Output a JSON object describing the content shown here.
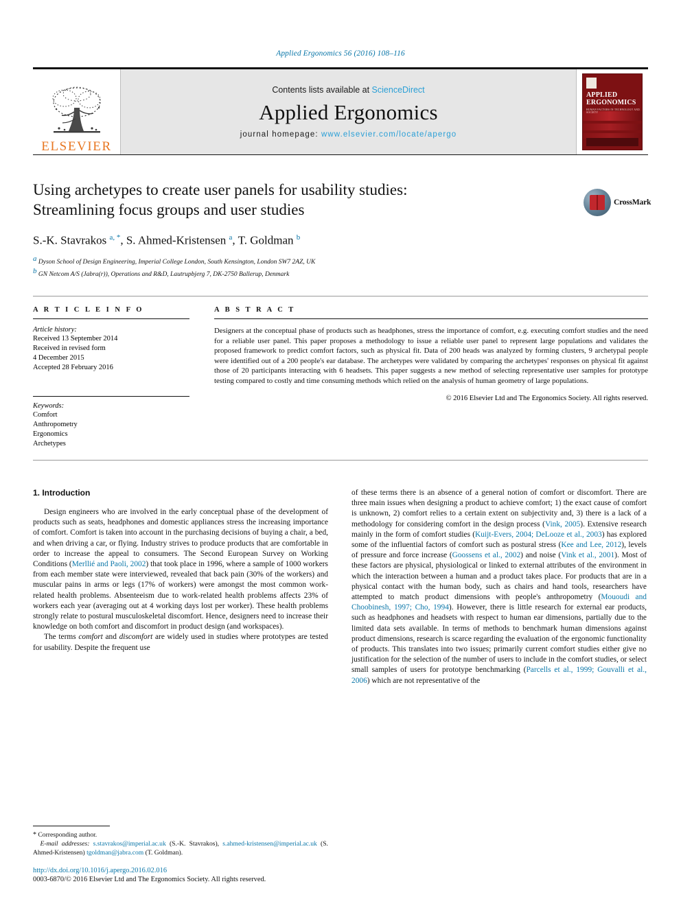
{
  "running_head": "Applied Ergonomics 56 (2016) 108–116",
  "masthead": {
    "publisher_wordmark": "ELSEVIER",
    "contents_prefix": "Contents lists available at ",
    "contents_link": "ScienceDirect",
    "journal_name": "Applied Ergonomics",
    "homepage_prefix": "journal homepage: ",
    "homepage_url": "www.elsevier.com/locate/apergo",
    "cover_title": "APPLIED ERGONOMICS",
    "cover_subtitle": "HUMAN FACTORS IN TECHNOLOGY AND SOCIETY"
  },
  "article": {
    "title": "Using archetypes to create user panels for usability studies: Streamlining focus groups and user studies",
    "crossmark_label": "CrossMark",
    "authors_html": "S.-K. Stavrakos <sup>a, *</sup>, S. Ahmed-Kristensen <sup>a</sup>, T. Goldman <sup>b</sup>",
    "affiliations": [
      {
        "marker": "a",
        "text": "Dyson School of Design Engineering, Imperial College London, South Kensington, London SW7 2AZ, UK"
      },
      {
        "marker": "b",
        "text": "GN Netcom A/S (Jabra(r)), Operations and R&D, Lautrupbjerg 7, DK-2750 Ballerup, Denmark"
      }
    ]
  },
  "article_info": {
    "heading": "A R T I C L E   I N F O",
    "history_title": "Article history:",
    "history_lines": [
      "Received 13 September 2014",
      "Received in revised form",
      "4 December 2015",
      "Accepted 28 February 2016"
    ],
    "keywords_title": "Keywords:",
    "keywords": [
      "Comfort",
      "Anthropometry",
      "Ergonomics",
      "Archetypes"
    ]
  },
  "abstract": {
    "heading": "A B S T R A C T",
    "text": "Designers at the conceptual phase of products such as headphones, stress the importance of comfort, e.g. executing comfort studies and the need for a reliable user panel. This paper proposes a methodology to issue a reliable user panel to represent large populations and validates the proposed framework to predict comfort factors, such as physical fit. Data of 200 heads was analyzed by forming clusters, 9 archetypal people were identified out of a 200 people's ear database. The archetypes were validated by comparing the archetypes' responses on physical fit against those of 20 participants interacting with 6 headsets. This paper suggests a new method of selecting representative user samples for prototype testing compared to costly and time consuming methods which relied on the analysis of human geometry of large populations.",
    "copyright": "© 2016 Elsevier Ltd and The Ergonomics Society. All rights reserved."
  },
  "introduction": {
    "section_title": "1. Introduction",
    "left_paragraphs": [
      "Design engineers who are involved in the early conceptual phase of the development of products such as seats, headphones and domestic appliances stress the increasing importance of comfort. Comfort is taken into account in the purchasing decisions of buying a chair, a bed, and when driving a car, or flying. Industry strives to produce products that are comfortable in order to increase the appeal to consumers. The Second European Survey on Working Conditions (Merllié and Paoli, 2002) that took place in 1996, where a sample of 1000 workers from each member state were interviewed, revealed that back pain (30% of the workers) and muscular pains in arms or legs (17% of workers) were amongst the most common work-related health problems. Absenteeism due to work-related health problems affects 23% of workers each year (averaging out at 4 working days lost per worker). These health problems strongly relate to postural musculoskeletal discomfort. Hence, designers need to increase their knowledge on both comfort and discomfort in product design (and workspaces).",
      "The terms comfort and discomfort are widely used in studies where prototypes are tested for usability. Despite the frequent use"
    ],
    "right_paragraphs": [
      "of these terms there is an absence of a general notion of comfort or discomfort. There are three main issues when designing a product to achieve comfort; 1) the exact cause of comfort is unknown, 2) comfort relies to a certain extent on subjectivity and, 3) there is a lack of a methodology for considering comfort in the design process (Vink, 2005). Extensive research mainly in the form of comfort studies (Kuijt-Evers, 2004; DeLooze et al., 2003) has explored some of the influential factors of comfort such as postural stress (Kee and Lee, 2012), levels of pressure and force increase (Goossens et al., 2002) and noise (Vink et al., 2001). Most of these factors are physical, physiological or linked to external attributes of the environment in which the interaction between a human and a product takes place. For products that are in a physical contact with the human body, such as chairs and hand tools, researchers have attempted to match product dimensions with people's anthropometry (Mououdi and Choobinesh, 1997; Cho, 1994). However, there is little research for external ear products, such as headphones and headsets with respect to human ear dimensions, partially due to the limited data sets available. In terms of methods to benchmark human dimensions against product dimensions, research is scarce regarding the evaluation of the ergonomic functionality of products. This translates into two issues; primarily current comfort studies either give no justification for the selection of the number of users to include in the comfort studies, or select small samples of users for prototype benchmarking (Parcells et al., 1999; Gouvalli et al., 2006) which are not representative of the"
    ]
  },
  "footnote": {
    "corresponding_marker": "*",
    "corresponding_text": "Corresponding author.",
    "email_label": "E-mail addresses:",
    "emails": [
      {
        "address": "s.stavrakos@imperial.ac.uk",
        "owner": "(S.-K. Stavrakos)"
      },
      {
        "address": "s.ahmed-kristensen@imperial.ac.uk",
        "owner": "(S. Ahmed-Kristensen)"
      },
      {
        "address": "tgoldman@jabra.com",
        "owner": "(T. Goldman)"
      }
    ],
    "doi": "http://dx.doi.org/10.1016/j.apergo.2016.02.016",
    "issn_line": "0003-6870/© 2016 Elsevier Ltd and The Ergonomics Society. All rights reserved."
  },
  "colors": {
    "link": "#0a76a8",
    "sciencedirect": "#2a9fd6",
    "elsevier_orange": "#e87722",
    "cover_red": "#7d1113"
  }
}
